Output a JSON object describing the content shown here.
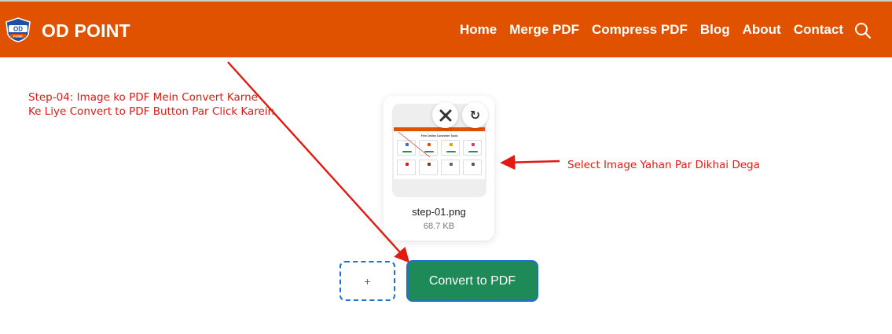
{
  "header": {
    "logo_text": "OD POINT",
    "brand": "OD POINT",
    "nav": [
      "Home",
      "Merge PDF",
      "Compress PDF",
      "Blog",
      "About",
      "Contact"
    ]
  },
  "annotations": {
    "left_note_line1": "Step-04: Image ko PDF Mein Convert Karne",
    "left_note_line2": "Ke Liye Convert to PDF Button Par Click Karein",
    "right_note": "Select Image Yahan Par Dikhai Dega"
  },
  "file_card": {
    "thumbnail_title": "Free Online Converter Tools",
    "file_name": "step-01.png",
    "file_size": "68.7 KB",
    "remove_icon": "close-icon",
    "rotate_icon": "rotate-icon"
  },
  "actions": {
    "add_label": "+",
    "convert_label": "Convert to PDF"
  },
  "colors": {
    "header": "#e05200",
    "annotation": "#e21a12",
    "convert": "#1e8a57",
    "border_blue": "#1f6fd1"
  }
}
